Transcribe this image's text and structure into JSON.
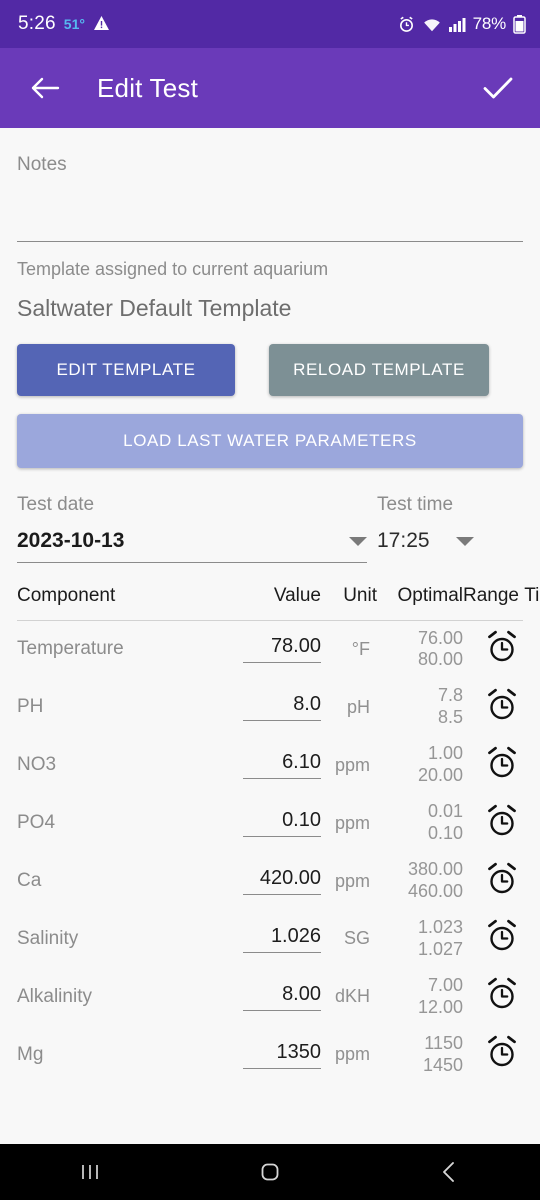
{
  "status_bar": {
    "time": "5:26",
    "temperature": "51°",
    "warning_icon": "warning-triangle-icon",
    "alarm_icon": "alarm-icon",
    "wifi_icon": "wifi-icon",
    "signal_icon": "cellular-signal-icon",
    "battery_text": "78%",
    "battery_icon": "battery-icon",
    "background": "#5229a5",
    "temp_color": "#56b9f0"
  },
  "app_bar": {
    "back_icon": "back-arrow-icon",
    "title": "Edit Test",
    "confirm_icon": "check-icon",
    "background": "#6a3ab9"
  },
  "notes": {
    "label": "Notes",
    "value": "",
    "placeholder": ""
  },
  "template": {
    "assigned_label": "Template assigned to current aquarium",
    "name": "Saltwater Default Template",
    "edit_button": "EDIT TEMPLATE",
    "reload_button": "RELOAD TEMPLATE",
    "load_button": "LOAD LAST WATER PARAMETERS",
    "edit_color": "#5465b5",
    "reload_color": "#7d9095",
    "load_color": "#9ba7dc"
  },
  "test_date": {
    "label": "Test date",
    "value": "2023-10-13",
    "dropdown_icon": "chevron-down-icon"
  },
  "test_time": {
    "label": "Test time",
    "value": "17:25",
    "dropdown_icon": "chevron-down-icon"
  },
  "table": {
    "headers": {
      "component": "Component",
      "value": "Value",
      "unit": "Unit",
      "optimal": "Optimal",
      "range": "Range",
      "timer": "Timer"
    },
    "rows": [
      {
        "component": "Temperature",
        "value": "78.00",
        "unit": "°F",
        "optimal_low": "76.00",
        "optimal_high": "80.00",
        "timer_icon": "alarm-clock-icon"
      },
      {
        "component": "PH",
        "value": "8.0",
        "unit": "pH",
        "optimal_low": "7.8",
        "optimal_high": "8.5",
        "timer_icon": "alarm-clock-icon"
      },
      {
        "component": "NO3",
        "value": "6.10",
        "unit": "ppm",
        "optimal_low": "1.00",
        "optimal_high": "20.00",
        "timer_icon": "alarm-clock-icon"
      },
      {
        "component": "PO4",
        "value": "0.10",
        "unit": "ppm",
        "optimal_low": "0.01",
        "optimal_high": "0.10",
        "timer_icon": "alarm-clock-icon"
      },
      {
        "component": "Ca",
        "value": "420.00",
        "unit": "ppm",
        "optimal_low": "380.00",
        "optimal_high": "460.00",
        "timer_icon": "alarm-clock-icon"
      },
      {
        "component": "Salinity",
        "value": "1.026",
        "unit": "SG",
        "optimal_low": "1.023",
        "optimal_high": "1.027",
        "timer_icon": "alarm-clock-icon"
      },
      {
        "component": "Alkalinity",
        "value": "8.00",
        "unit": "dKH",
        "optimal_low": "7.00",
        "optimal_high": "12.00",
        "timer_icon": "alarm-clock-icon"
      },
      {
        "component": "Mg",
        "value": "1350",
        "unit": "ppm",
        "optimal_low": "1150",
        "optimal_high": "1450",
        "timer_icon": "alarm-clock-icon"
      }
    ]
  },
  "nav_bar": {
    "recents_icon": "recents-icon",
    "home_icon": "home-icon",
    "back_icon": "nav-back-icon"
  }
}
